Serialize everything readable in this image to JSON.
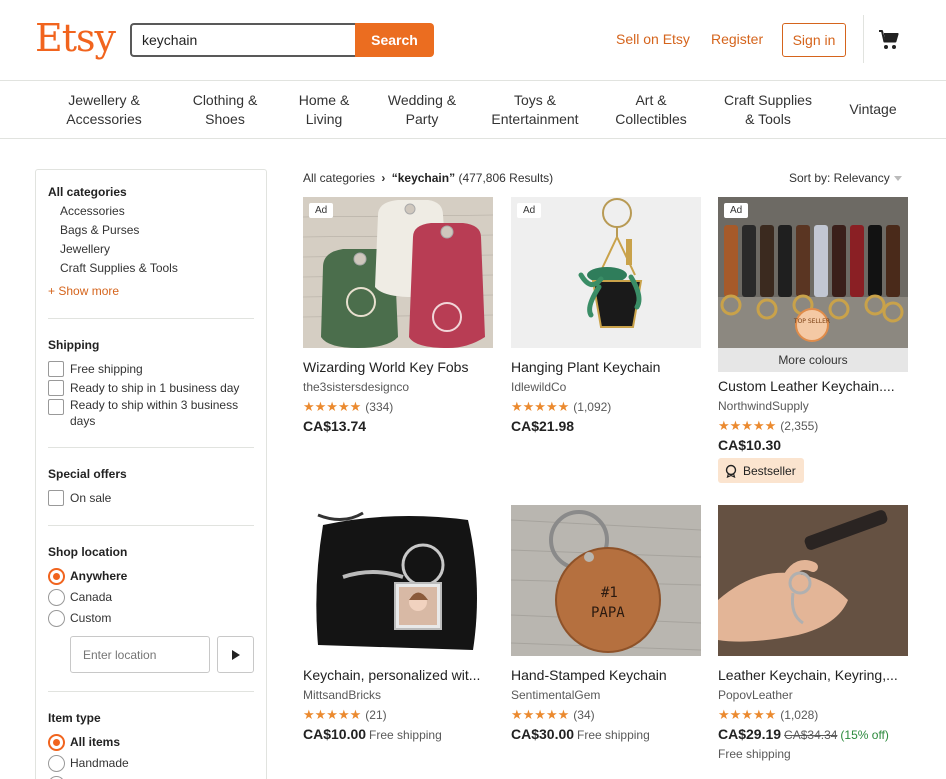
{
  "header": {
    "logo": "Etsy",
    "search_value": "keychain",
    "search_button": "Search",
    "sell_link": "Sell on Etsy",
    "register_link": "Register",
    "signin_button": "Sign in"
  },
  "categories": [
    [
      "Jewellery &",
      "Accessories"
    ],
    [
      "Clothing &",
      "Shoes"
    ],
    [
      "Home &",
      "Living"
    ],
    [
      "Wedding &",
      "Party"
    ],
    [
      "Toys &",
      "Entertainment"
    ],
    [
      "Art &",
      "Collectibles"
    ],
    [
      "Craft Supplies",
      "& Tools"
    ],
    [
      "Vintage"
    ]
  ],
  "sidebar": {
    "all_categories": "All categories",
    "category_links": [
      "Accessories",
      "Bags & Purses",
      "Jewellery",
      "Craft Supplies & Tools"
    ],
    "show_more": "+ Show more",
    "shipping_heading": "Shipping",
    "shipping_options": [
      "Free shipping",
      "Ready to ship in 1 business day",
      "Ready to ship within 3 business",
      "days"
    ],
    "special_offers_heading": "Special offers",
    "on_sale": "On sale",
    "shop_location_heading": "Shop location",
    "location_options": [
      "Anywhere",
      "Canada",
      "Custom"
    ],
    "location_selected": "Anywhere",
    "location_placeholder": "Enter location",
    "item_type_heading": "Item type",
    "item_type_options": [
      "All items",
      "Handmade"
    ],
    "item_type_selected": "All items"
  },
  "results": {
    "breadcrumb_root": "All categories",
    "query": "“keychain”",
    "count": "(477,806 Results)",
    "sort_label": "Sort by: Relevancy"
  },
  "listings": [
    {
      "ad": "Ad",
      "title": "Wizarding World Key Fobs",
      "shop": "the3sistersdesignco",
      "stars": "★★★★★",
      "reviews": "(334)",
      "price": "CA$13.74"
    },
    {
      "ad": "Ad",
      "title": "Hanging Plant Keychain",
      "shop": "IdlewildCo",
      "stars": "★★★★★",
      "reviews": "(1,092)",
      "price": "CA$21.98"
    },
    {
      "ad": "Ad",
      "title": "Custom Leather Keychain....",
      "shop": "NorthwindSupply",
      "stars": "★★★★★",
      "reviews": "(2,355)",
      "price": "CA$10.30",
      "more_colours": "More colours",
      "badge": "Bestseller",
      "top_seller": "TOP SELLER"
    },
    {
      "title": "Keychain, personalized wit...",
      "shop": "MittsandBricks",
      "stars": "★★★★★",
      "reviews": "(21)",
      "price": "CA$10.00",
      "shipping": "Free shipping"
    },
    {
      "title": "Hand-Stamped Keychain",
      "shop": "SentimentalGem",
      "stars": "★★★★★",
      "reviews": "(34)",
      "price": "CA$30.00",
      "shipping": "Free shipping",
      "stamp_line1": "#1",
      "stamp_line2": "PAPA"
    },
    {
      "title": "Leather Keychain, Keyring,...",
      "shop": "PopovLeather",
      "stars": "★★★★★",
      "reviews": "(1,028)",
      "price": "CA$29.19",
      "old_price": "CA$34.34",
      "discount": "(15% off)",
      "shipping": "Free shipping"
    }
  ]
}
